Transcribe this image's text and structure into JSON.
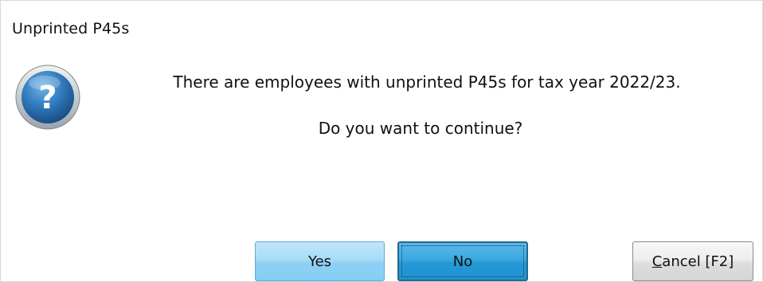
{
  "dialog": {
    "title": "Unprinted P45s",
    "icon": "question-icon",
    "message_line1": "There are employees with unprinted P45s for tax year 2022/23.",
    "message_line2": "Do you want to continue?"
  },
  "buttons": {
    "yes_label": "Yes",
    "no_label": "No",
    "cancel_label": "Cancel [F2]"
  },
  "colors": {
    "yes_button": "#a8dcf8",
    "no_button_focused": "#2499d6",
    "cancel_button": "#e4e4e4",
    "icon_blue": "#2a6fb0"
  }
}
